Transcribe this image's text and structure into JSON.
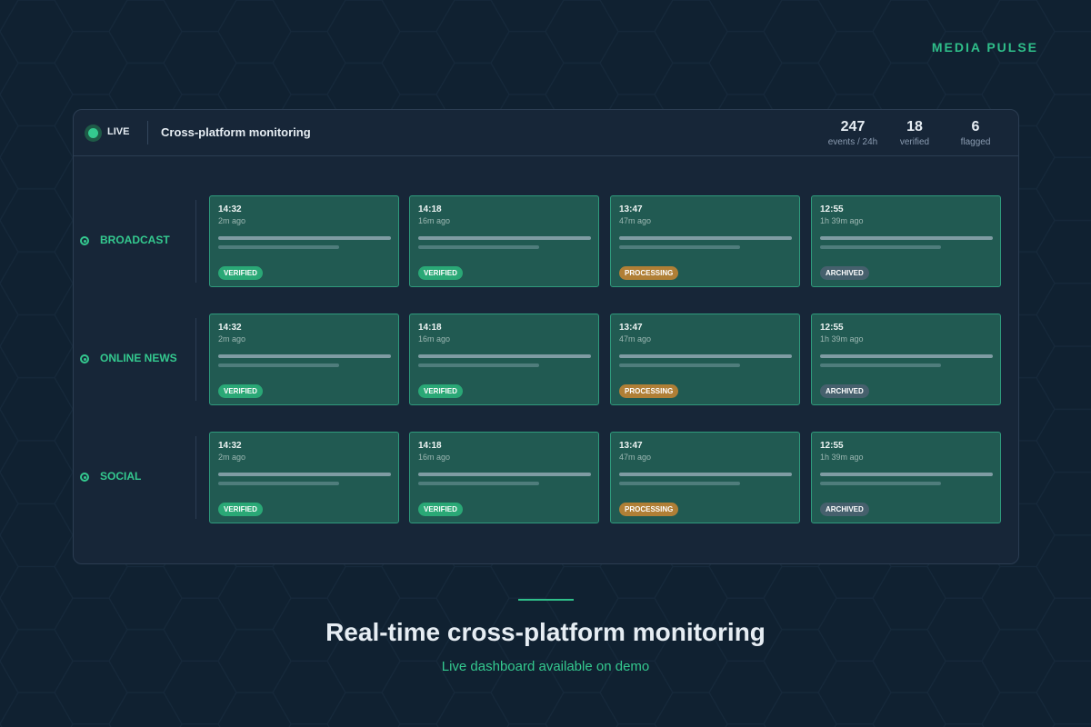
{
  "brand": "MEDIA PULSE",
  "header": {
    "live_label": "LIVE",
    "title": "Cross-platform monitoring",
    "stats": [
      {
        "value": "247",
        "label": "events / 24h"
      },
      {
        "value": "18",
        "label": "verified"
      },
      {
        "value": "6",
        "label": "flagged"
      }
    ]
  },
  "statuses": {
    "verified": {
      "label": "VERIFIED",
      "color": "#2aa876"
    },
    "processing": {
      "label": "PROCESSING",
      "color": "#b07f36"
    },
    "archived": {
      "label": "ARCHIVED",
      "color": "#46606d"
    }
  },
  "rows": [
    {
      "label": "BROADCAST",
      "cards": [
        {
          "time": "14:32",
          "ago": "2m ago",
          "status": "verified"
        },
        {
          "time": "14:18",
          "ago": "16m ago",
          "status": "verified"
        },
        {
          "time": "13:47",
          "ago": "47m ago",
          "status": "processing"
        },
        {
          "time": "12:55",
          "ago": "1h 39m ago",
          "status": "archived"
        }
      ]
    },
    {
      "label": "ONLINE NEWS",
      "cards": [
        {
          "time": "14:32",
          "ago": "2m ago",
          "status": "verified"
        },
        {
          "time": "14:18",
          "ago": "16m ago",
          "status": "verified"
        },
        {
          "time": "13:47",
          "ago": "47m ago",
          "status": "processing"
        },
        {
          "time": "12:55",
          "ago": "1h 39m ago",
          "status": "archived"
        }
      ]
    },
    {
      "label": "SOCIAL",
      "cards": [
        {
          "time": "14:32",
          "ago": "2m ago",
          "status": "verified"
        },
        {
          "time": "14:18",
          "ago": "16m ago",
          "status": "verified"
        },
        {
          "time": "13:47",
          "ago": "47m ago",
          "status": "processing"
        },
        {
          "time": "12:55",
          "ago": "1h 39m ago",
          "status": "archived"
        }
      ]
    }
  ],
  "footer": {
    "title": "Real-time cross-platform monitoring",
    "subtitle": "Live dashboard available on demo"
  },
  "colors": {
    "background": "#102131",
    "accent": "#34c98f",
    "panel": "#172638",
    "card": "#215a52"
  }
}
